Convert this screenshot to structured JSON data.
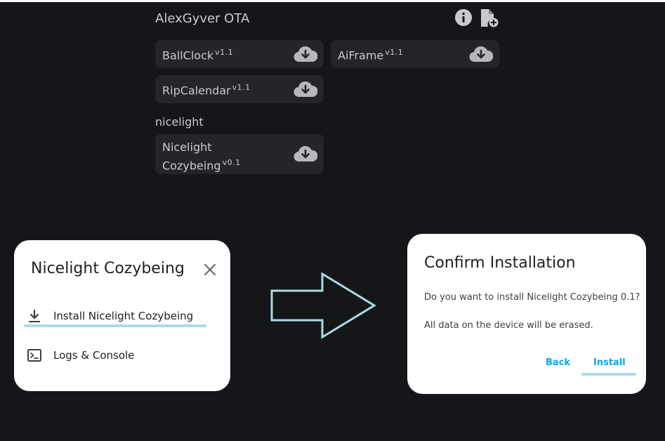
{
  "header": {
    "title": "AlexGyver OTA",
    "info_icon": "info-icon",
    "add_file_icon": "file-add-icon"
  },
  "projects": [
    {
      "name": "BallClock",
      "version": "v1.1"
    },
    {
      "name": "AiFrame",
      "version": "v1.1"
    },
    {
      "name": "RipCalendar",
      "version": "v1.1"
    }
  ],
  "groups": [
    {
      "label": "nicelight",
      "items": [
        {
          "name_line1": "Nicelight",
          "name_line2": "Cozybeing",
          "version": "v0.1"
        }
      ]
    }
  ],
  "dialog_menu": {
    "title": "Nicelight Cozybeing",
    "items": [
      {
        "label": "Install Nicelight Cozybeing",
        "icon": "download-icon"
      },
      {
        "label": "Logs & Console",
        "icon": "terminal-icon"
      }
    ]
  },
  "dialog_confirm": {
    "title": "Confirm Installation",
    "question": "Do you want to install Nicelight Cozybeing 0.1?",
    "warning": "All data on the device will be erased.",
    "back_label": "Back",
    "install_label": "Install"
  },
  "colors": {
    "background": "#151619",
    "card": "#24252a",
    "accent": "#03a9f4",
    "highlight": "#a9dce6"
  }
}
